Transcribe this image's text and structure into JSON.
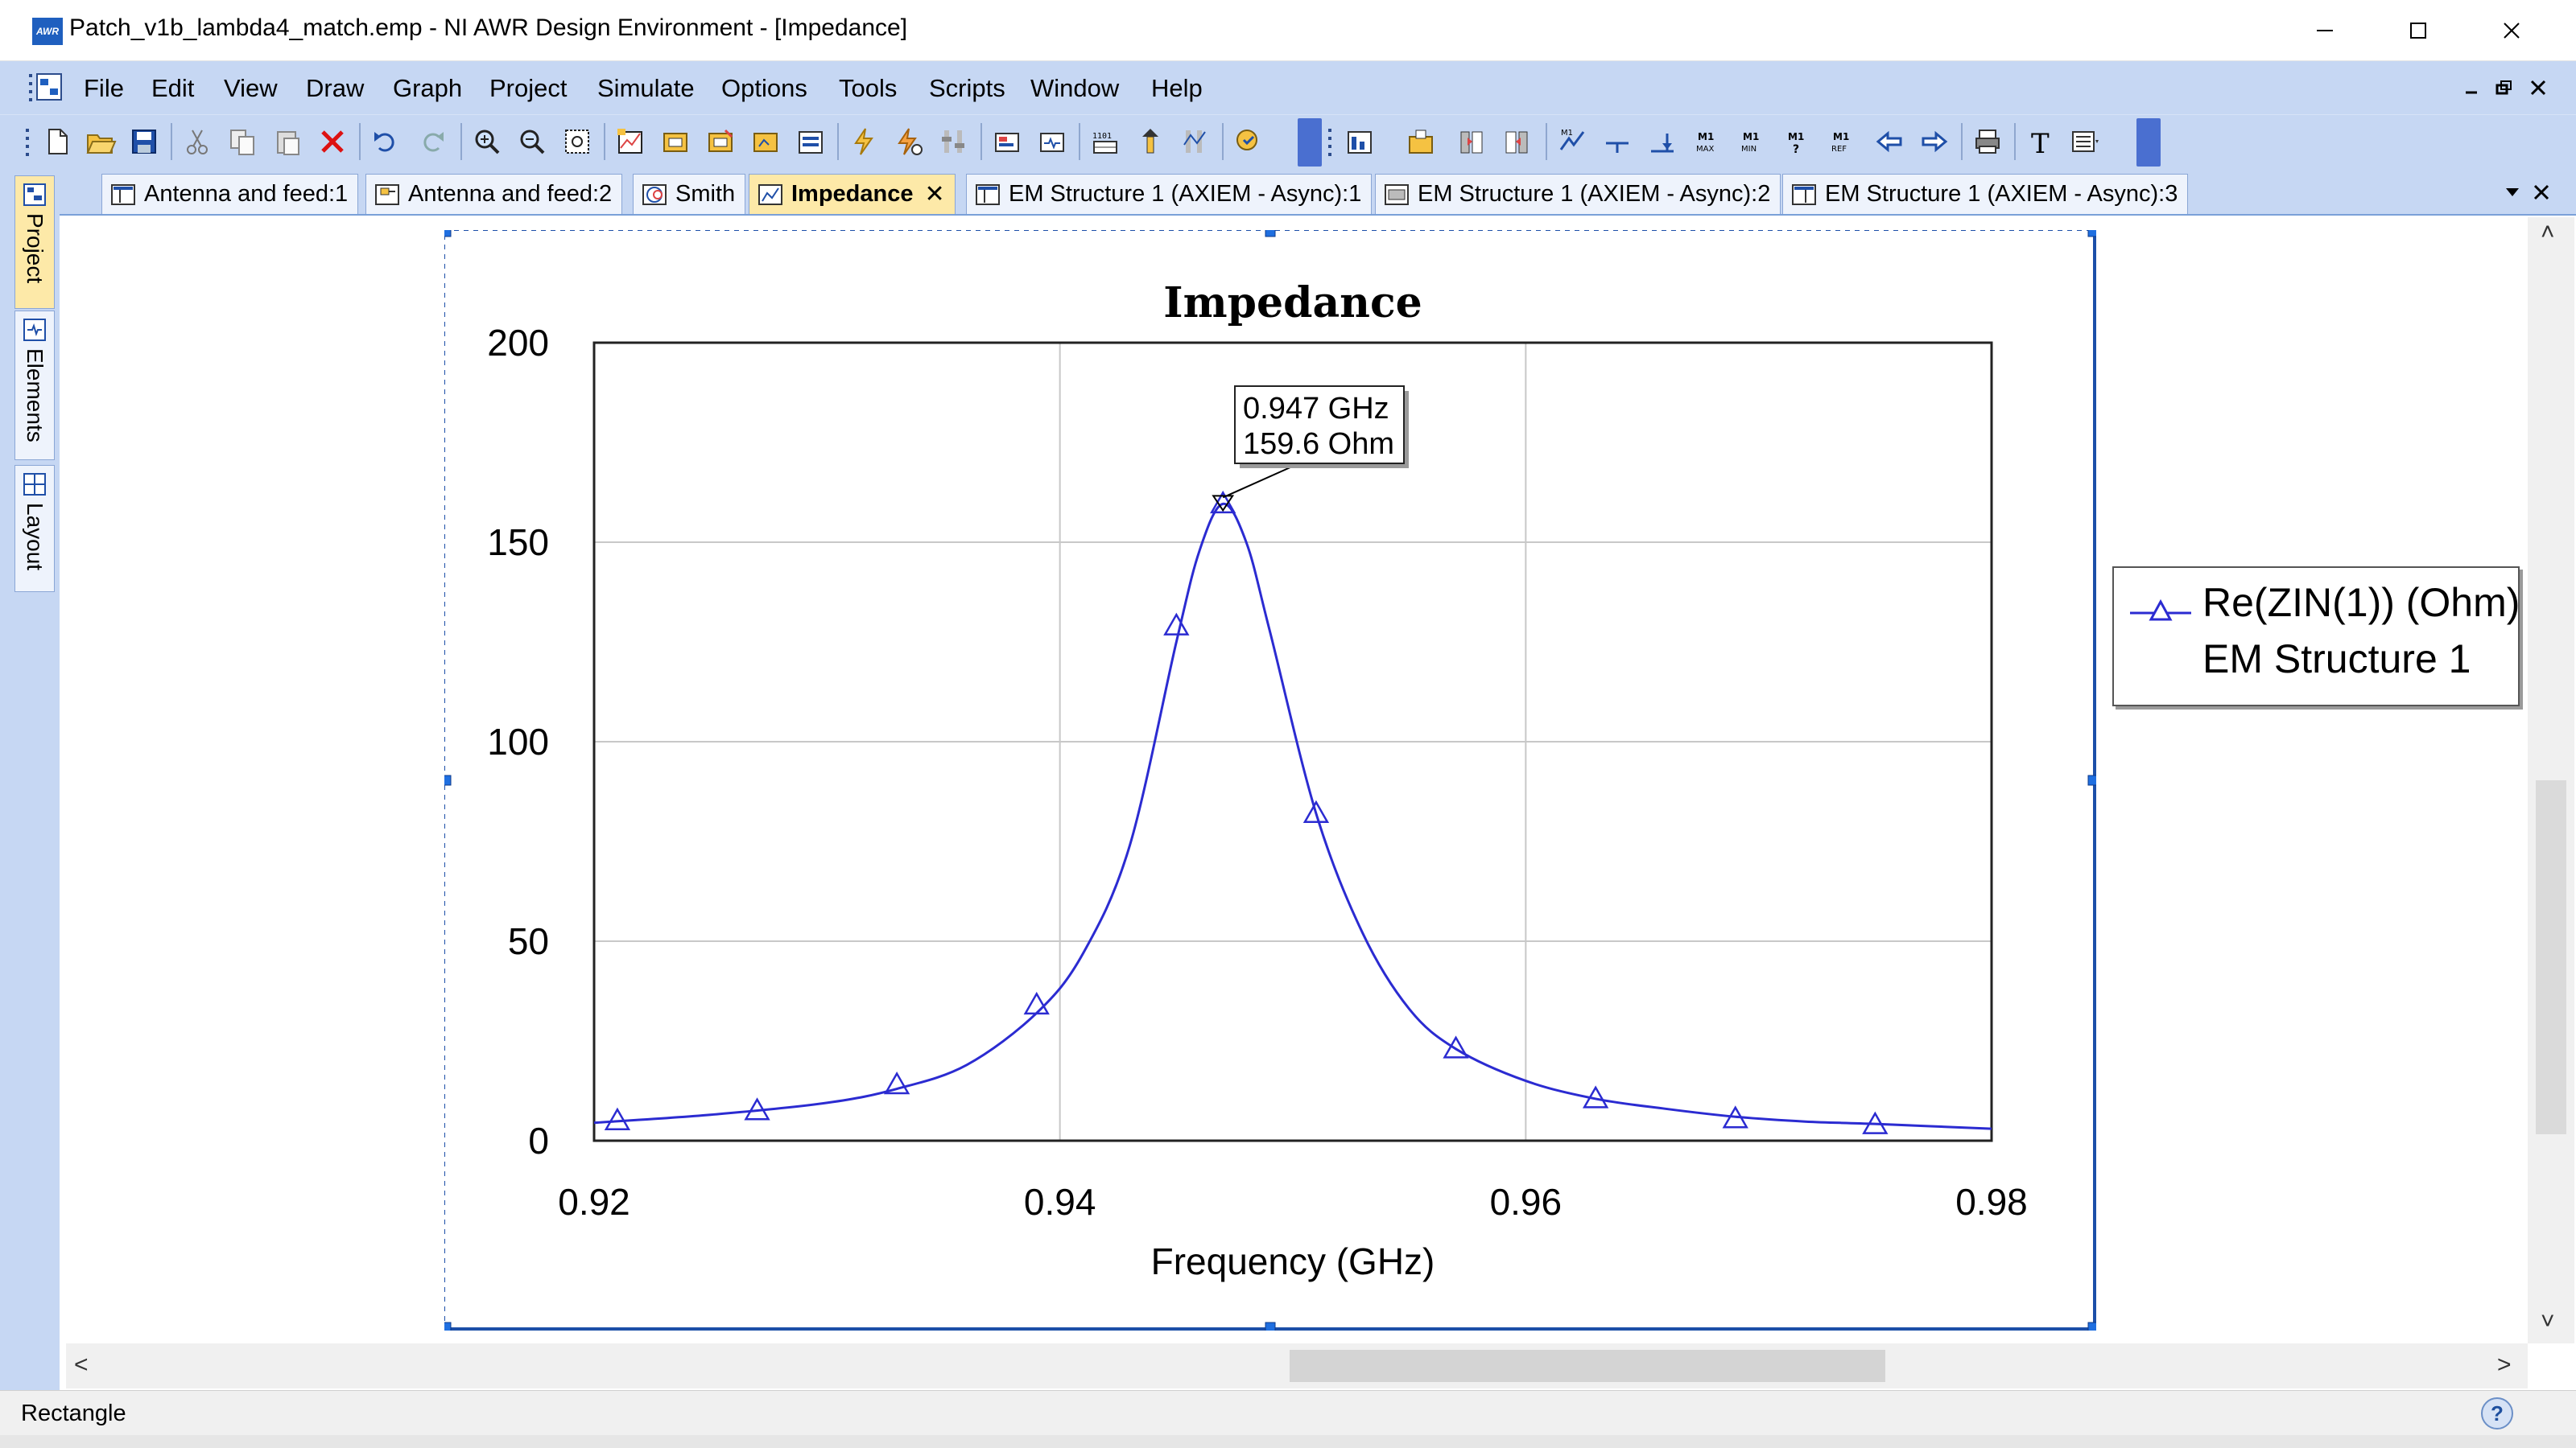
{
  "window": {
    "title": "Patch_v1b_lambda4_match.emp - NI AWR Design Environment - [Impedance]",
    "app_icon_text": "AWR"
  },
  "menu": {
    "items": [
      "File",
      "Edit",
      "View",
      "Draw",
      "Graph",
      "Project",
      "Simulate",
      "Options",
      "Tools",
      "Scripts",
      "Window",
      "Help"
    ]
  },
  "toolbar": {
    "icons": [
      "new-icon",
      "open-icon",
      "save-icon",
      "cut-icon",
      "copy-icon",
      "paste-icon",
      "delete-icon",
      "undo-icon",
      "redo-icon",
      "zoom-area-icon",
      "zoom-out-icon",
      "zoom-fit-icon",
      "add-graph-icon",
      "add-measurement-icon",
      "modify-measurement-icon",
      "add-marker-icon",
      "properties-icon",
      "simulate-icon",
      "analyze-icon",
      "tune-icon",
      "layout-icon",
      "schematic-icon",
      "data-table-icon",
      "tune-tool-icon",
      "yield-icon",
      "optimize-icon",
      "graph-properties-icon",
      "add-marker-graph-icon",
      "marker-left-icon",
      "marker-right-icon",
      "marker-search-icon",
      "marker-line-icon",
      "marker-peak-icon",
      "marker-max-icon",
      "marker-min-icon",
      "marker-query-icon",
      "marker-ref-icon",
      "prev-icon",
      "next-icon",
      "print-icon",
      "text-icon",
      "legend-icon"
    ],
    "marker_labels": {
      "max": "MAX",
      "min": "MIN",
      "ref": "REF",
      "m1": "M1"
    }
  },
  "tabs": [
    {
      "label": "Antenna and feed:1",
      "active": false
    },
    {
      "label": "Antenna and feed:2",
      "active": false
    },
    {
      "label": "Smith",
      "active": false
    },
    {
      "label": "Impedance",
      "active": true
    },
    {
      "label": "EM Structure 1 (AXIEM - Async):1",
      "active": false
    },
    {
      "label": "EM Structure 1 (AXIEM - Async):2",
      "active": false
    },
    {
      "label": "EM Structure 1 (AXIEM - Async):3",
      "active": false
    }
  ],
  "dock": {
    "tabs": [
      "Project",
      "Elements",
      "Layout"
    ]
  },
  "status": {
    "text": "Rectangle"
  },
  "chart_data": {
    "type": "line",
    "title": "Impedance",
    "xlabel": "Frequency (GHz)",
    "ylabel": "",
    "xlim": [
      0.92,
      0.98
    ],
    "ylim": [
      0,
      200
    ],
    "xticks": [
      "0.92",
      "0.94",
      "0.96",
      "0.98"
    ],
    "yticks": [
      "0",
      "50",
      "100",
      "150",
      "200"
    ],
    "grid": true,
    "legend_position": "right",
    "series": [
      {
        "name": "Re(ZIN(1)) (Ohm)",
        "source": "EM Structure 1",
        "color": "#2b2bd1",
        "marker": "triangle",
        "x": [
          0.92,
          0.925,
          0.93,
          0.933,
          0.936,
          0.939,
          0.941,
          0.943,
          0.945,
          0.946,
          0.947,
          0.948,
          0.949,
          0.951,
          0.953,
          0.955,
          0.957,
          0.96,
          0.963,
          0.966,
          0.969,
          0.972,
          0.975,
          0.98
        ],
        "y": [
          4.5,
          6.5,
          9.5,
          13,
          19,
          32,
          47,
          74,
          125,
          148,
          159.6,
          150,
          128,
          82,
          52,
          33,
          23,
          15,
          10.5,
          8,
          6,
          4.8,
          4.2,
          3
        ],
        "marker_x": [
          0.921,
          0.927,
          0.933,
          0.939,
          0.945,
          0.947,
          0.951,
          0.957,
          0.963,
          0.969,
          0.975
        ],
        "marker_y": [
          5,
          7.5,
          14,
          34,
          129,
          159.6,
          82,
          23,
          10.5,
          5.5,
          4
        ]
      }
    ],
    "annotation": {
      "x": 0.947,
      "y": 159.6,
      "line1": "0.947 GHz",
      "line2": "159.6 Ohm"
    }
  },
  "legend": {
    "line1": "Re(ZIN(1)) (Ohm)",
    "line2": "EM Structure 1"
  }
}
